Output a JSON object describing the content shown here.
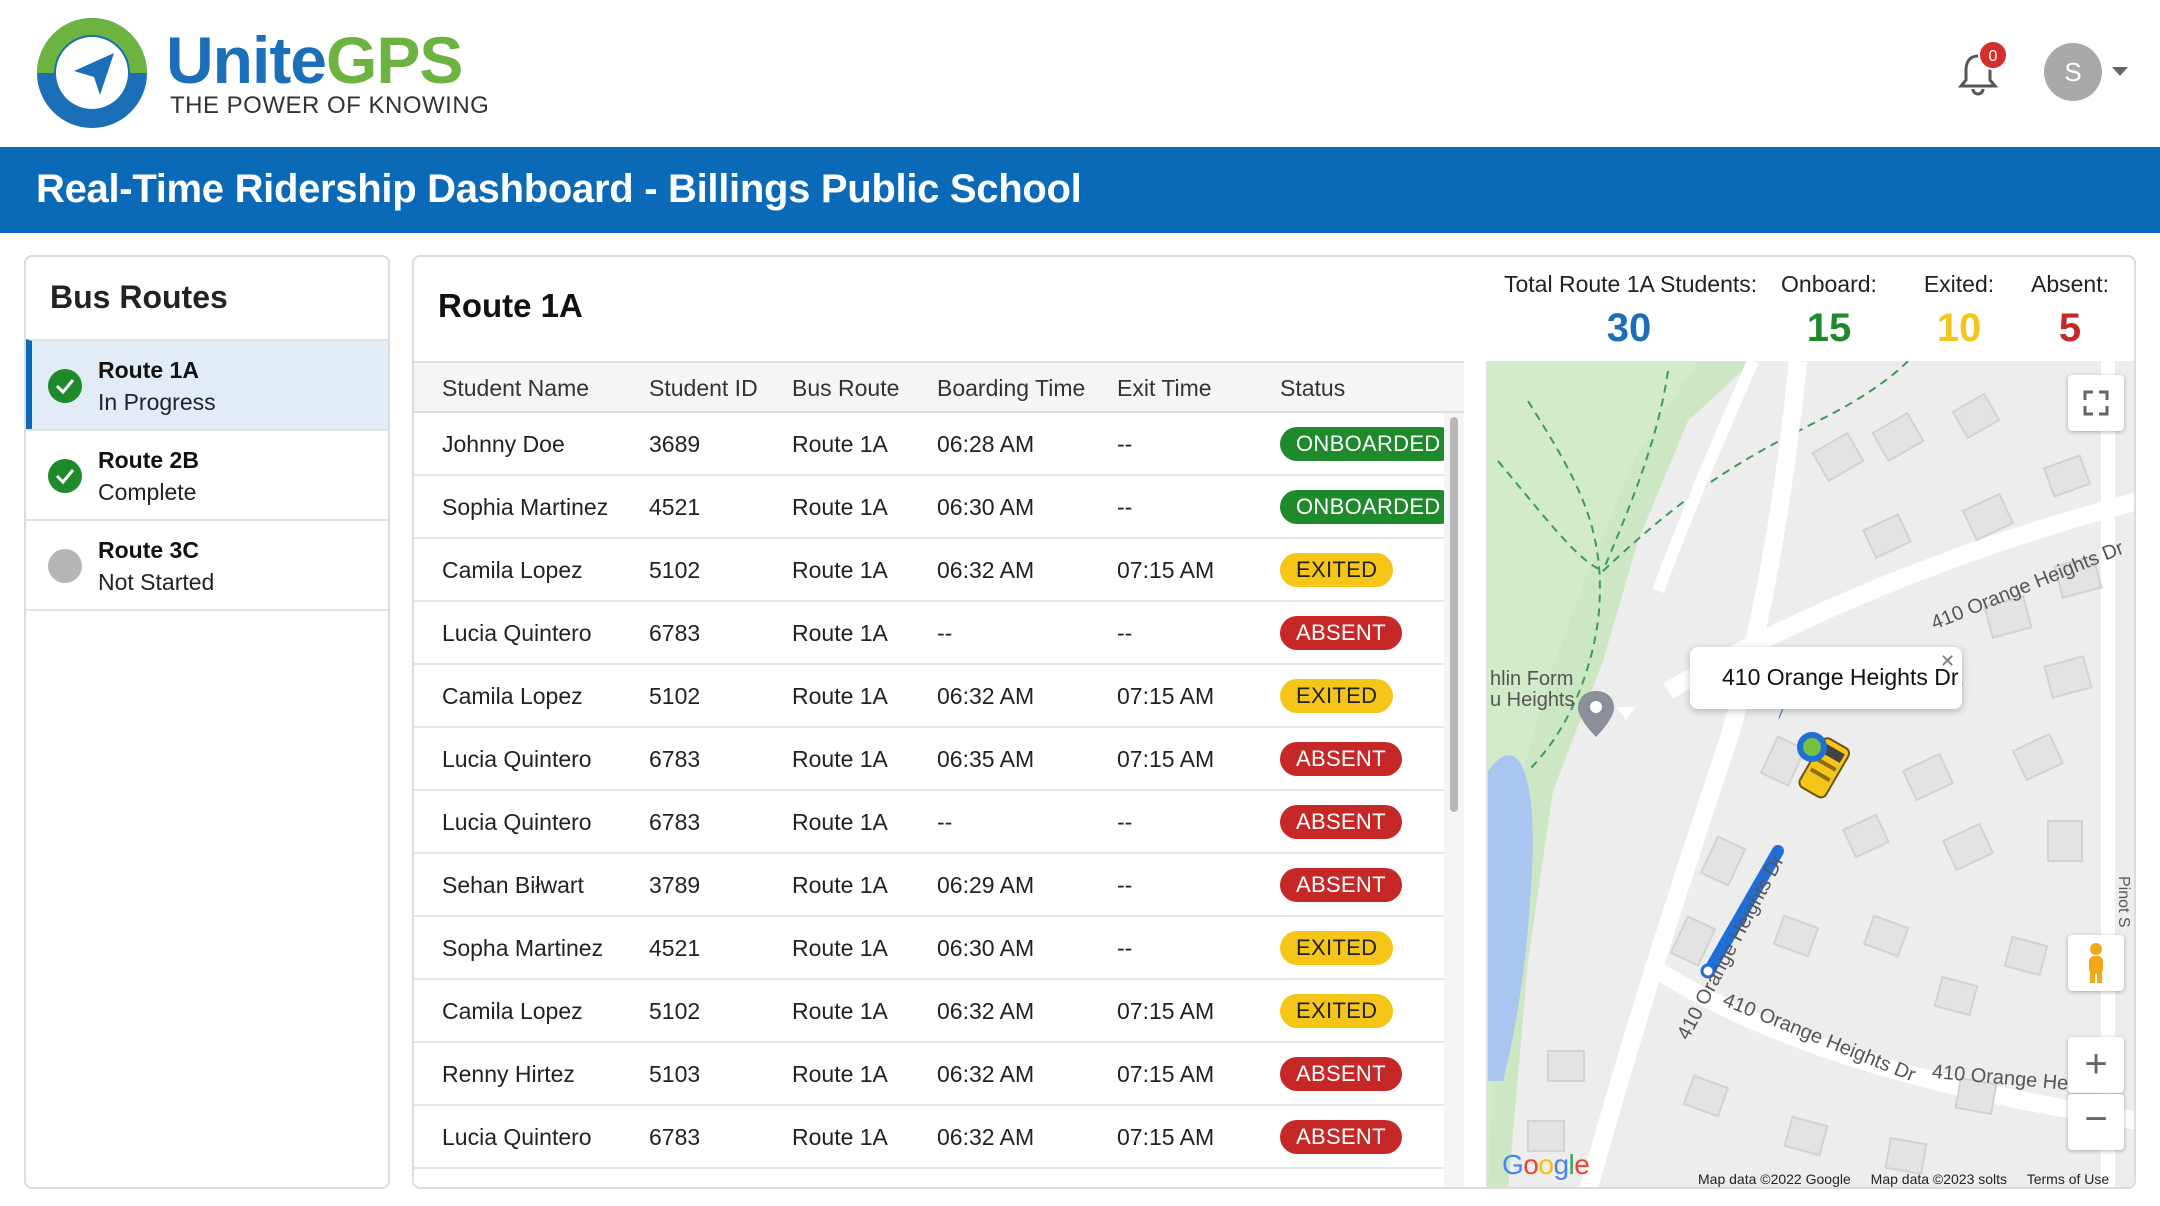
{
  "brand": {
    "name_part1": "Unite",
    "name_part2": "GPS",
    "tagline": "THE POWER OF KNOWING"
  },
  "header": {
    "notification_count": "0",
    "avatar_initial": "S"
  },
  "page_title": "Real-Time Ridership Dashboard - Billings Public School",
  "sidebar": {
    "title": "Bus Routes",
    "items": [
      {
        "name": "Route 1A",
        "status": "In Progress",
        "icon": "check-circle-icon",
        "active": true
      },
      {
        "name": "Route 2B",
        "status": "Complete",
        "icon": "check-circle-icon",
        "active": false
      },
      {
        "name": "Route 3C",
        "status": "Not Started",
        "icon": "grey-circle-icon",
        "active": false
      }
    ]
  },
  "main": {
    "route_title": "Route 1A",
    "stats": {
      "total_label": "Total Route 1A Students:",
      "total_value": "30",
      "onboard_label": "Onboard:",
      "onboard_value": "15",
      "exited_label": "Exited:",
      "exited_value": "10",
      "absent_label": "Absent:",
      "absent_value": "5"
    },
    "colors": {
      "total": "#1b6fb8",
      "onboard": "#1f8a2c",
      "exited": "#f5c518",
      "absent": "#c62828"
    },
    "table": {
      "columns": [
        "Student Name",
        "Student ID",
        "Bus Route",
        "Boarding Time",
        "Exit Time",
        "Status"
      ],
      "rows": [
        {
          "name": "Johnny Doe",
          "id": "3689",
          "route": "Route 1A",
          "boarding": "06:28 AM",
          "exit": "--",
          "status": "ONBOARDED"
        },
        {
          "name": "Sophia Martinez",
          "id": "4521",
          "route": "Route 1A",
          "boarding": "06:30 AM",
          "exit": "--",
          "status": "ONBOARDED"
        },
        {
          "name": "Camila Lopez",
          "id": "5102",
          "route": "Route 1A",
          "boarding": "06:32 AM",
          "exit": "07:15 AM",
          "status": "EXITED"
        },
        {
          "name": "Lucia Quintero",
          "id": "6783",
          "route": "Route 1A",
          "boarding": "--",
          "exit": "--",
          "status": "ABSENT"
        },
        {
          "name": "Camila Lopez",
          "id": "5102",
          "route": "Route 1A",
          "boarding": "06:32 AM",
          "exit": "07:15 AM",
          "status": "EXITED"
        },
        {
          "name": "Lucia Quintero",
          "id": "6783",
          "route": "Route 1A",
          "boarding": "06:35 AM",
          "exit": "07:15 AM",
          "status": "ABSENT"
        },
        {
          "name": "Lucia Quintero",
          "id": "6783",
          "route": "Route 1A",
          "boarding": "--",
          "exit": "--",
          "status": "ABSENT"
        },
        {
          "name": "Sehan Biłwart",
          "id": "3789",
          "route": "Route 1A",
          "boarding": "06:29 AM",
          "exit": "--",
          "status": "ABSENT"
        },
        {
          "name": "Sopha Martinez",
          "id": "4521",
          "route": "Route 1A",
          "boarding": "06:30 AM",
          "exit": "--",
          "status": "EXITED"
        },
        {
          "name": "Camila Lopez",
          "id": "5102",
          "route": "Route 1A",
          "boarding": "06:32 AM",
          "exit": "07:15 AM",
          "status": "EXITED"
        },
        {
          "name": "Renny Hirtez",
          "id": "5103",
          "route": "Route 1A",
          "boarding": "06:32 AM",
          "exit": "07:15 AM",
          "status": "ABSENT"
        },
        {
          "name": "Lucia Quintero",
          "id": "6783",
          "route": "Route 1A",
          "boarding": "06:32 AM",
          "exit": "07:15 AM",
          "status": "ABSENT"
        }
      ]
    }
  },
  "map": {
    "popup_text": "410 Orange Heights Dr",
    "street_labels": [
      "410 Orange Heights Dr",
      "410 Orange Heights Dr",
      "410 Orange Heights Dr",
      "410 Orange Hei"
    ],
    "poi_label_line1": "hlin Form",
    "poi_label_line2": "u Heights",
    "side_label": "Pinot S",
    "google_logo": "Google",
    "footer": [
      "Map data ©2022 Google",
      "Map data ©2023 solts",
      "Terms of Use"
    ],
    "icons": [
      "fullscreen-icon",
      "pegman-icon",
      "zoom-in-icon",
      "zoom-out-icon",
      "bus-icon",
      "location-pin-icon"
    ]
  }
}
